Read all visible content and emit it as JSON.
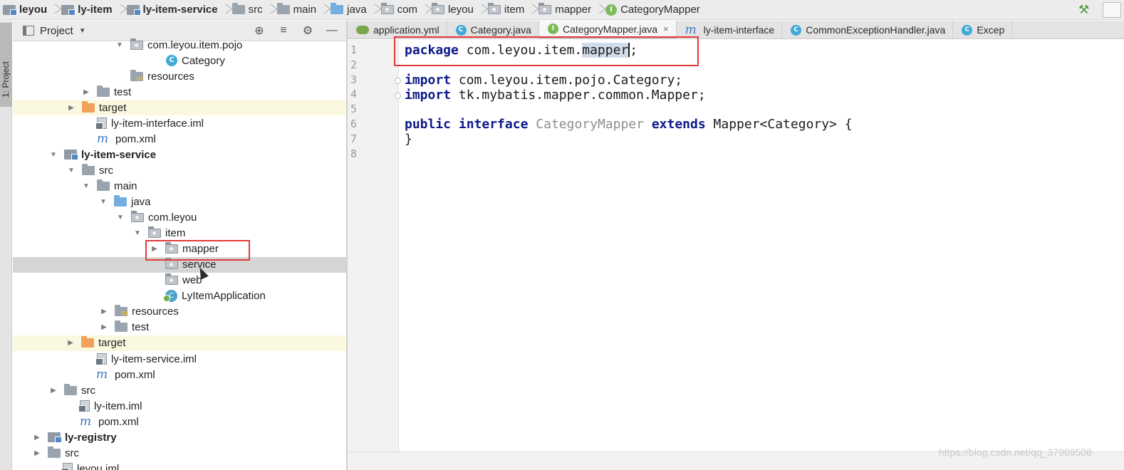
{
  "breadcrumbs": [
    {
      "label": "leyou",
      "icon": "module-folder-icon",
      "bold": true
    },
    {
      "label": "ly-item",
      "icon": "module-folder-icon",
      "bold": true
    },
    {
      "label": "ly-item-service",
      "icon": "module-folder-icon",
      "bold": true
    },
    {
      "label": "src",
      "icon": "folder-icon",
      "bold": false
    },
    {
      "label": "main",
      "icon": "folder-icon",
      "bold": false
    },
    {
      "label": "java",
      "icon": "source-folder-icon",
      "bold": false
    },
    {
      "label": "com",
      "icon": "package-icon",
      "bold": false
    },
    {
      "label": "leyou",
      "icon": "package-icon",
      "bold": false
    },
    {
      "label": "item",
      "icon": "package-icon",
      "bold": false
    },
    {
      "label": "mapper",
      "icon": "package-icon",
      "bold": false
    },
    {
      "label": "CategoryMapper",
      "icon": "interface-icon",
      "bold": false
    }
  ],
  "project_panel": {
    "title": "Project",
    "side_tab_label": "1: Project"
  },
  "tree": [
    {
      "label": "com.leyou.item.pojo",
      "icon": "pkg",
      "arrow": "down"
    },
    {
      "label": "Category",
      "icon": "class",
      "arrow": "none"
    },
    {
      "label": "resources",
      "icon": "res",
      "arrow": "none"
    },
    {
      "label": "test",
      "icon": "folder",
      "arrow": "right"
    },
    {
      "label": "target",
      "icon": "orange",
      "arrow": "right",
      "state": "yellow"
    },
    {
      "label": "ly-item-interface.iml",
      "icon": "iml",
      "arrow": "none"
    },
    {
      "label": "pom.xml",
      "icon": "m",
      "arrow": "none"
    },
    {
      "label": "ly-item-service",
      "icon": "mod",
      "arrow": "down",
      "bold": true
    },
    {
      "label": "src",
      "icon": "folder",
      "arrow": "down"
    },
    {
      "label": "main",
      "icon": "folder",
      "arrow": "down"
    },
    {
      "label": "java",
      "icon": "blue",
      "arrow": "down"
    },
    {
      "label": "com.leyou",
      "icon": "pkg",
      "arrow": "down"
    },
    {
      "label": "item",
      "icon": "pkg",
      "arrow": "down"
    },
    {
      "label": "mapper",
      "icon": "pkg",
      "arrow": "right"
    },
    {
      "label": "service",
      "icon": "pkg",
      "arrow": "none",
      "state": "selected"
    },
    {
      "label": "web",
      "icon": "pkg",
      "arrow": "none"
    },
    {
      "label": "LyItemApplication",
      "icon": "app",
      "arrow": "none"
    },
    {
      "label": "resources",
      "icon": "res",
      "arrow": "right"
    },
    {
      "label": "test",
      "icon": "folder",
      "arrow": "right"
    },
    {
      "label": "target",
      "icon": "orange",
      "arrow": "right",
      "state": "yellow"
    },
    {
      "label": "ly-item-service.iml",
      "icon": "iml",
      "arrow": "none"
    },
    {
      "label": "pom.xml",
      "icon": "m",
      "arrow": "none"
    },
    {
      "label": "src",
      "icon": "folder",
      "arrow": "right"
    },
    {
      "label": "ly-item.iml",
      "icon": "iml",
      "arrow": "none"
    },
    {
      "label": "pom.xml",
      "icon": "m",
      "arrow": "none"
    },
    {
      "label": "ly-registry",
      "icon": "mod",
      "arrow": "right",
      "bold": true
    },
    {
      "label": "src",
      "icon": "folder",
      "arrow": "right"
    },
    {
      "label": "leyou.iml",
      "icon": "iml",
      "arrow": "none"
    }
  ],
  "tabs": [
    {
      "label": "application.yml",
      "icon": "yml",
      "active": false,
      "close": ""
    },
    {
      "label": "Category.java",
      "icon": "class",
      "active": false,
      "close": ""
    },
    {
      "label": "CategoryMapper.java",
      "icon": "intf",
      "active": true,
      "close": "×"
    },
    {
      "label": "ly-item-interface",
      "icon": "m",
      "active": false,
      "close": ""
    },
    {
      "label": "CommonExceptionHandler.java",
      "icon": "class",
      "active": false,
      "close": ""
    },
    {
      "label": "Excep",
      "icon": "class",
      "active": false,
      "close": ""
    }
  ],
  "code": {
    "line_numbers": [
      "1",
      "2",
      "3",
      "4",
      "5",
      "6",
      "7",
      "8"
    ],
    "line1": {
      "kw": "package",
      "text": " com.leyou.item.",
      "sel": "mapper",
      "end": ";"
    },
    "line3": {
      "kw": "import",
      "text": " com.leyou.item.pojo.Category;"
    },
    "line4": {
      "kw": "import",
      "text": " tk.mybatis.mapper.common.Mapper;"
    },
    "line6": {
      "kw1": "public",
      "kw2": "interface",
      "name": "CategoryMapper",
      "kw3": "extends",
      "text": " Mapper<Category> {"
    },
    "line7": {
      "text": "}"
    }
  },
  "watermark": "https://blog.csdn.net/qq_37909508",
  "colors": {
    "highlight": "#e23a3a",
    "keyword": "#0d1a8a",
    "selected_row": "#d5d5d5",
    "excluded_row": "#fbf8e0"
  }
}
